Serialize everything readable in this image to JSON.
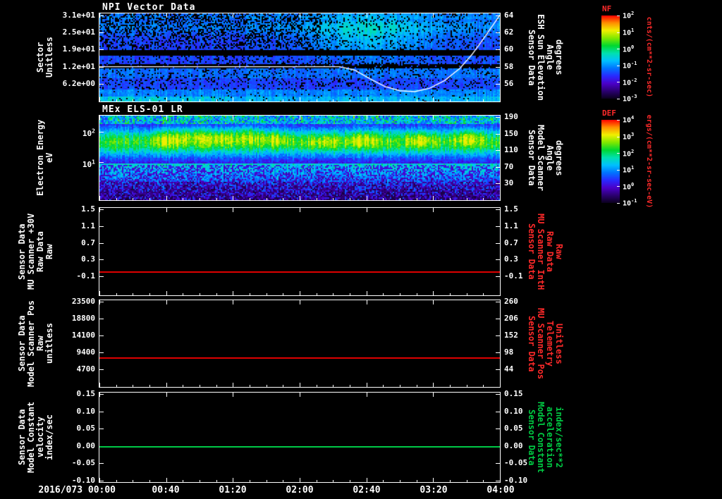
{
  "page": {
    "background": "#000000",
    "text_color": "#ffffff",
    "accent_red": "#ff2a2a",
    "accent_green": "#00cc44"
  },
  "titles": {
    "panel1": "NPI Vector Data",
    "panel2": "MEx ELS-01 LR"
  },
  "colormap": {
    "stops": [
      "#0a001c",
      "#2b0070",
      "#4b00c8",
      "#2929ff",
      "#0073ff",
      "#00bfff",
      "#00e0b0",
      "#00d830",
      "#7fe800",
      "#f0f000",
      "#ff9000",
      "#ff0000"
    ]
  },
  "time_axis": {
    "start_label": "2016/073 00:00",
    "labels": [
      "00:40",
      "01:20",
      "02:00",
      "02:40",
      "03:20",
      "04:00"
    ],
    "start": "2016/073 00:00",
    "end": "2016/073 04:00",
    "major_tick_interval_minutes": 40,
    "minor_tick_interval_minutes": 10
  },
  "colorbars": [
    {
      "title": "NF",
      "title_color": "#ff2a2a",
      "unit": "cnts/(cm**2-sr-sec)",
      "unit_color": "#ff2a2a",
      "ticks": [
        "10^2",
        "10^1",
        "10^0",
        "10^-1",
        "10^-2",
        "10^-3"
      ]
    },
    {
      "title": "DEF",
      "title_color": "#ff2a2a",
      "unit": "ergs/(cm**2-sr-sec-eV)",
      "unit_color": "#ff2a2a",
      "ticks": [
        "10^4",
        "10^3",
        "10^2",
        "10^1",
        "10^0",
        "10^-1"
      ]
    }
  ],
  "panels": [
    {
      "id": "panel-npi",
      "kind": "spectrogram",
      "seed": 20163,
      "left_label": "Sector\nUnitless",
      "right_label": "Sensor Data\nESH Sun Elevation\nAngle\ndegrees",
      "right_label_color": "#ffffff",
      "left_ticks": [
        {
          "label": "3.1e+01",
          "frac": 0.02
        },
        {
          "label": "2.5e+01",
          "frac": 0.215
        },
        {
          "label": "1.9e+01",
          "frac": 0.41
        },
        {
          "label": "1.2e+01",
          "frac": 0.605
        },
        {
          "label": "6.2e+00",
          "frac": 0.8
        }
      ],
      "right_ticks": [
        {
          "label": "64",
          "frac": 0.02
        },
        {
          "label": "62",
          "frac": 0.215
        },
        {
          "label": "60",
          "frac": 0.41
        },
        {
          "label": "58",
          "frac": 0.605
        },
        {
          "label": "56",
          "frac": 0.8
        }
      ]
    },
    {
      "id": "panel-els",
      "kind": "spectrogram",
      "seed": 777,
      "left_label": "Electron Energy\neV",
      "right_label": "Sensor Data\nModel Scanner\nAngle\ndegrees",
      "right_label_color": "#ffffff",
      "left_ticks": [
        {
          "label": "10^2",
          "frac": 0.19
        },
        {
          "label": "10^1",
          "frac": 0.55
        }
      ],
      "right_ticks": [
        {
          "label": "190",
          "frac": 0.02
        },
        {
          "label": "150",
          "frac": 0.215
        },
        {
          "label": "110",
          "frac": 0.41
        },
        {
          "label": "70",
          "frac": 0.605
        },
        {
          "label": "30",
          "frac": 0.8
        }
      ]
    },
    {
      "id": "panel-mu30v",
      "kind": "line",
      "left_label": "Sensor Data\nMU Scanner +30V\nRaw Data\nRaw",
      "right_label": "Sensor Data\nMU Scanner IntH\nRaw Data\nRaw",
      "right_label_color": "#ff2a2a",
      "left_ticks": [
        {
          "label": "1.5",
          "frac": 0.02
        },
        {
          "label": "1.1",
          "frac": 0.21
        },
        {
          "label": "0.7",
          "frac": 0.4
        },
        {
          "label": "0.3",
          "frac": 0.59
        },
        {
          "label": "-0.1",
          "frac": 0.78
        }
      ],
      "right_ticks": [
        {
          "label": "1.5",
          "frac": 0.02
        },
        {
          "label": "1.1",
          "frac": 0.21
        },
        {
          "label": "0.7",
          "frac": 0.4
        },
        {
          "label": "0.3",
          "frac": 0.59
        },
        {
          "label": "-0.1",
          "frac": 0.78
        }
      ],
      "line": {
        "value": 0.0,
        "frac": 0.725,
        "color": "#dd0000"
      }
    },
    {
      "id": "panel-scanpos",
      "kind": "line",
      "left_label": "Sensor Data\nModel Scanner Pos\nRaw\nunitless",
      "right_label": "Sensor Data\nMU Scanner Pos\nTelemetry\nUnitless",
      "right_label_color": "#ff2a2a",
      "left_ticks": [
        {
          "label": "23500",
          "frac": 0.02
        },
        {
          "label": "18800",
          "frac": 0.215
        },
        {
          "label": "14100",
          "frac": 0.41
        },
        {
          "label": "9400",
          "frac": 0.6
        },
        {
          "label": "4700",
          "frac": 0.8
        }
      ],
      "right_ticks": [
        {
          "label": "260",
          "frac": 0.02
        },
        {
          "label": "206",
          "frac": 0.215
        },
        {
          "label": "152",
          "frac": 0.41
        },
        {
          "label": "98",
          "frac": 0.6
        },
        {
          "label": "44",
          "frac": 0.8
        }
      ],
      "line": {
        "value": 8100,
        "frac": 0.655,
        "color": "#dd0000"
      }
    },
    {
      "id": "panel-velocity",
      "kind": "line",
      "left_label": "Sensor Data\nModel Constant\nvelocity\nindex/sec",
      "right_label": "Sensor Data\nModel Constant\nacceleration\nindex/sec**2",
      "right_label_color": "#00cc44",
      "left_ticks": [
        {
          "label": "0.15",
          "frac": 0.015
        },
        {
          "label": "0.10",
          "frac": 0.21
        },
        {
          "label": "0.05",
          "frac": 0.4
        },
        {
          "label": "0.00",
          "frac": 0.6
        },
        {
          "label": "-0.05",
          "frac": 0.79
        },
        {
          "label": "-0.10",
          "frac": 0.985
        }
      ],
      "right_ticks": [
        {
          "label": "0.15",
          "frac": 0.015
        },
        {
          "label": "0.10",
          "frac": 0.21
        },
        {
          "label": "0.05",
          "frac": 0.4
        },
        {
          "label": "0.00",
          "frac": 0.6
        },
        {
          "label": "-0.05",
          "frac": 0.79
        },
        {
          "label": "-0.10",
          "frac": 0.985
        }
      ],
      "line": {
        "value": 0.0,
        "frac": 0.6,
        "color": "#00c846"
      }
    }
  ],
  "chart_data": [
    {
      "type": "heatmap",
      "title": "NPI Vector Data",
      "x_range": [
        "2016/073 00:00",
        "2016/073 04:00"
      ],
      "ylabel": "Sector (Unitless)",
      "y_ticks": [
        31,
        25,
        19,
        12,
        6.2
      ],
      "right_axis_label": "Sensor Data ESH Sun Elevation Angle (degrees)",
      "right_axis_ticks": [
        64,
        62,
        60,
        58,
        56
      ],
      "colorbar": {
        "name": "NF",
        "unit": "cnts/(cm**2-sr-sec)",
        "ticks": [
          "10^2",
          "10^1",
          "10^0",
          "10^-1",
          "10^-2",
          "10^-3"
        ]
      },
      "appearance": "Blue/violet count spectrogram with black dropout speckles concentrated before ~02:00, solid black bands across sectors ~17-19 and ~13-14, a brighter cyan-blue region ~02:00-03:30 in the upper sectors, and a brighter band along the lowest sectors",
      "overlay_line": {
        "name": "ESH Sun Elevation Angle",
        "color": "#ffffff",
        "units": "degrees",
        "points_hours_deg": [
          [
            0,
            58
          ],
          [
            2.4,
            58
          ],
          [
            2.55,
            57.6
          ],
          [
            2.7,
            56.6
          ],
          [
            2.85,
            55.7
          ],
          [
            3.0,
            55.2
          ],
          [
            3.15,
            55.1
          ],
          [
            3.3,
            55.5
          ],
          [
            3.45,
            56.4
          ],
          [
            3.6,
            57.8
          ],
          [
            3.72,
            59.4
          ],
          [
            3.82,
            61.0
          ],
          [
            3.91,
            62.5
          ],
          [
            4.0,
            64.0
          ]
        ]
      }
    },
    {
      "type": "heatmap",
      "title": "MEx ELS-01 LR",
      "x_range": [
        "2016/073 00:00",
        "2016/073 04:00"
      ],
      "ylabel": "Electron Energy (eV)",
      "y_scale": "log",
      "y_ticks": [
        "10^2",
        "10^1"
      ],
      "right_axis_label": "Sensor Data Model Scanner Angle (degrees)",
      "right_axis_ticks": [
        190,
        150,
        110,
        70,
        30
      ],
      "colorbar": {
        "name": "DEF",
        "unit": "ergs/(cm**2-sr-sec-eV)",
        "ticks": [
          "10^4",
          "10^3",
          "10^2",
          "10^1",
          "10^0",
          "10^-1"
        ]
      },
      "appearance": "Bright green band of electron flux between ~10 and ~100 eV persisting the full 4 hours, with yellow-green enhancements near 00:30-01:50, and speckled blue/dark low flux below ~10 eV"
    },
    {
      "type": "line",
      "title": "Sensor Data MU Scanner +30V Raw Data Raw",
      "x_range": [
        "2016/073 00:00",
        "2016/073 04:00"
      ],
      "y_ticks": [
        1.5,
        1.1,
        0.7,
        0.3,
        -0.1
      ],
      "series": [
        {
          "name": "MU Scanner +30V Raw",
          "color": "#dd0000",
          "constant_value": 0.0
        }
      ],
      "right_axis_label": "Sensor Data MU Scanner IntH Raw Data Raw",
      "right_axis_ticks": [
        1.5,
        1.1,
        0.7,
        0.3,
        -0.1
      ]
    },
    {
      "type": "line",
      "title": "Sensor Data Model Scanner Pos Raw unitless",
      "x_range": [
        "2016/073 00:00",
        "2016/073 04:00"
      ],
      "y_ticks": [
        23500,
        18800,
        14100,
        9400,
        4700
      ],
      "series": [
        {
          "name": "Model Scanner Pos Raw",
          "color": "#dd0000",
          "constant_value": 8100
        }
      ],
      "right_axis_label": "Sensor Data MU Scanner Pos Telemetry Unitless",
      "right_axis_ticks": [
        260,
        206,
        152,
        98,
        44
      ]
    },
    {
      "type": "line",
      "title": "Sensor Data Model Constant velocity index/sec",
      "x_range": [
        "2016/073 00:00",
        "2016/073 04:00"
      ],
      "y_ticks": [
        0.15,
        0.1,
        0.05,
        0.0,
        -0.05,
        -0.1
      ],
      "series": [
        {
          "name": "Model Constant velocity",
          "color": "#00c846",
          "constant_value": 0.0
        }
      ],
      "right_axis_label": "Sensor Data Model Constant acceleration index/sec**2",
      "right_axis_ticks": [
        0.15,
        0.1,
        0.05,
        0.0,
        -0.05,
        -0.1
      ]
    }
  ]
}
